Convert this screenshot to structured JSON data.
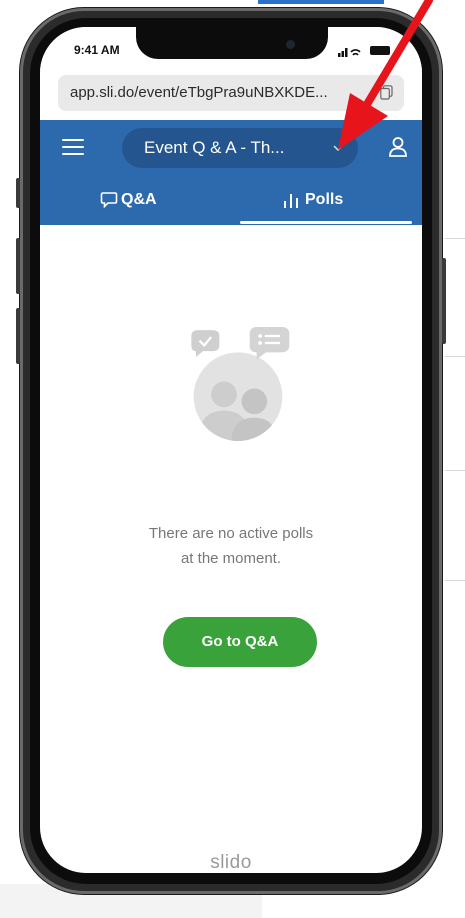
{
  "status_bar": {
    "time": "9:41 AM"
  },
  "browser": {
    "url": "app.sli.do/event/eTbgPra9uNBXKDE..."
  },
  "header": {
    "event_title": "Event Q & A - Th..."
  },
  "tabs": [
    {
      "label": "Q&A",
      "icon": "speech-bubble-icon",
      "active": false
    },
    {
      "label": "Polls",
      "icon": "bar-chart-icon",
      "active": true
    }
  ],
  "empty_state": {
    "line1": "There are no active polls",
    "line2": "at the moment.",
    "button_label": "Go to Q&A"
  },
  "brand": "slido",
  "colors": {
    "header": "#2d69ad",
    "pill": "#24558e",
    "button": "#3aa23a",
    "annotation_arrow": "#e8141c"
  }
}
